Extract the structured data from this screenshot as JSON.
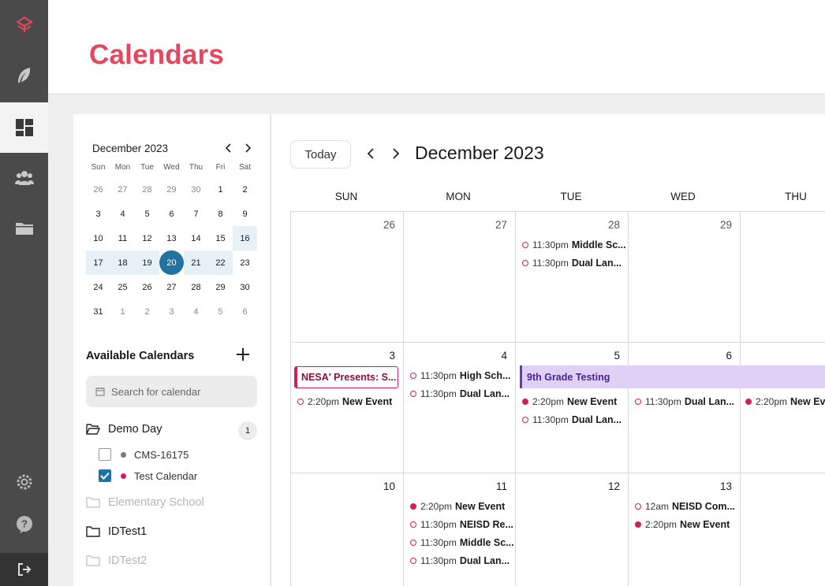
{
  "app": {
    "title": "Calendars"
  },
  "nav": {
    "items": [
      {
        "name": "logo-icon"
      },
      {
        "name": "feather-icon"
      },
      {
        "name": "dashboard-icon",
        "active": true
      },
      {
        "name": "people-icon"
      },
      {
        "name": "folder-icon"
      }
    ],
    "bottom": [
      "settings-icon",
      "help-icon",
      "logout-icon"
    ]
  },
  "mini_calendar": {
    "title": "December 2023",
    "weekdays": [
      "Sun",
      "Mon",
      "Tue",
      "Wed",
      "Thu",
      "Fri",
      "Sat"
    ],
    "weeks": [
      [
        "26",
        "27",
        "28",
        "29",
        "30",
        "1",
        "2"
      ],
      [
        "3",
        "4",
        "5",
        "6",
        "7",
        "8",
        "9"
      ],
      [
        "10",
        "11",
        "12",
        "13",
        "14",
        "15",
        "16"
      ],
      [
        "17",
        "18",
        "19",
        "20",
        "21",
        "22",
        "23"
      ],
      [
        "24",
        "25",
        "26",
        "27",
        "28",
        "29",
        "30"
      ],
      [
        "31",
        "1",
        "2",
        "3",
        "4",
        "5",
        "6"
      ]
    ],
    "selected": "20"
  },
  "available": {
    "title": "Available Calendars",
    "search_placeholder": "Search for calendar",
    "groups": [
      {
        "label": "Demo Day",
        "count": "1"
      },
      {
        "label": "Elementary School"
      },
      {
        "label": "IDTest1"
      },
      {
        "label": "IDTest2"
      }
    ],
    "items": [
      {
        "label": "CMS-16175",
        "color": "#7a7a7a",
        "checked": false
      },
      {
        "label": "Test Calendar",
        "color": "#d2215a",
        "checked": true
      }
    ]
  },
  "main": {
    "today_label": "Today",
    "title": "December 2023",
    "weekdays": [
      "SUN",
      "MON",
      "TUE",
      "WED",
      "THU"
    ],
    "accent": "#e5485e"
  },
  "events": {
    "w1": {
      "d26": "26",
      "d27": "27",
      "d28": "28",
      "d29": "29",
      "tue": [
        {
          "time": "11:30pm",
          "name": "Middle Sc..."
        },
        {
          "time": "11:30pm",
          "name": "Dual Lan..."
        }
      ]
    },
    "w2": {
      "d3": "3",
      "d4": "4",
      "d5": "5",
      "d6": "6",
      "banner_sun": "NESA' Presents: S...",
      "banner_span": "9th Grade Testing",
      "sun": [
        {
          "time": "2:20pm",
          "name": "New Event"
        }
      ],
      "mon": [
        {
          "time": "11:30pm",
          "name": "High Sch..."
        },
        {
          "time": "11:30pm",
          "name": "Dual Lan..."
        }
      ],
      "tue": [
        {
          "time": "2:20pm",
          "name": "New Event"
        },
        {
          "time": "11:30pm",
          "name": "Dual Lan..."
        }
      ],
      "wed": [
        {
          "time": "11:30pm",
          "name": "Dual Lan..."
        }
      ],
      "thu": [
        {
          "time": "2:20pm",
          "name": "New Ev"
        }
      ]
    },
    "w3": {
      "d10": "10",
      "d11": "11",
      "d12": "12",
      "d13": "13",
      "mon": [
        {
          "time": "2:20pm",
          "name": "New Event"
        },
        {
          "time": "11:30pm",
          "name": "NEISD Re..."
        },
        {
          "time": "11:30pm",
          "name": "Middle Sc..."
        },
        {
          "time": "11:30pm",
          "name": "Dual Lan..."
        }
      ],
      "wed": [
        {
          "time": "12am",
          "name": "NEISD Com..."
        },
        {
          "time": "2:20pm",
          "name": "New Event"
        }
      ]
    }
  }
}
